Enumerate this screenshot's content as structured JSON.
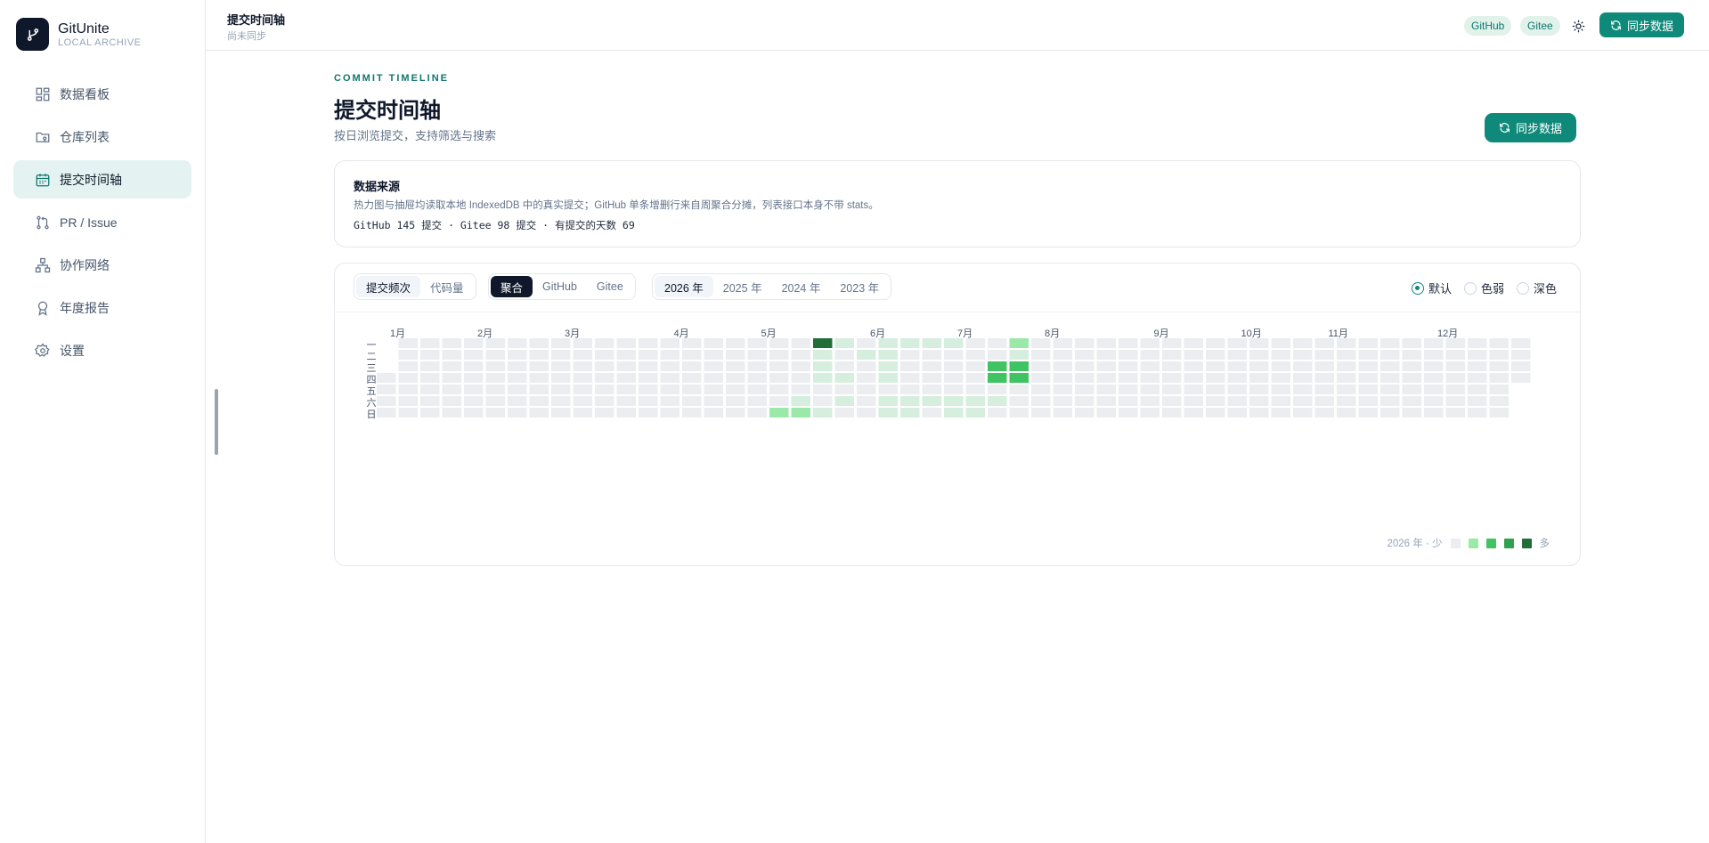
{
  "brand": {
    "name": "GitUnite",
    "subtitle": "LOCAL ARCHIVE"
  },
  "sidebar": {
    "items": [
      {
        "label": "数据看板",
        "icon": "dashboard-icon"
      },
      {
        "label": "仓库列表",
        "icon": "folder-repo-icon"
      },
      {
        "label": "提交时间轴",
        "icon": "calendar-icon",
        "active": true
      },
      {
        "label": "PR / Issue",
        "icon": "pull-request-icon"
      },
      {
        "label": "协作网络",
        "icon": "network-icon"
      },
      {
        "label": "年度报告",
        "icon": "award-icon"
      },
      {
        "label": "设置",
        "icon": "gear-icon"
      }
    ]
  },
  "header": {
    "title": "提交时间轴",
    "subtitle": "尚未同步",
    "tags": [
      "GitHub",
      "Gitee"
    ],
    "sync_label": "同步数据"
  },
  "page": {
    "eyebrow": "COMMIT TIMELINE",
    "title": "提交时间轴",
    "subtitle": "按日浏览提交，支持筛选与搜索",
    "sync_label": "同步数据"
  },
  "source": {
    "title": "数据来源",
    "description": "热力图与抽屉均读取本地 IndexedDB 中的真实提交；GitHub 单条增删行来自周聚合分摊，列表接口本身不带 stats。",
    "stats": "GitHub 145 提交 · Gitee 98 提交 · 有提交的天数 69"
  },
  "toolbar": {
    "metric_tabs": [
      "提交频次",
      "代码量"
    ],
    "metric_active": 0,
    "source_tabs": [
      "聚合",
      "GitHub",
      "Gitee"
    ],
    "source_active": 0,
    "year_tabs": [
      "2026 年",
      "2025 年",
      "2024 年",
      "2023 年"
    ],
    "year_active": 0,
    "palette_options": [
      "默认",
      "色弱",
      "深色"
    ],
    "palette_active": 0
  },
  "chart_data": {
    "type": "heatmap",
    "year": 2026,
    "months": [
      "1月",
      "2月",
      "3月",
      "4月",
      "5月",
      "6月",
      "7月",
      "8月",
      "9月",
      "10月",
      "11月",
      "12月"
    ],
    "weekdays": [
      "一",
      "二",
      "三",
      "四",
      "五",
      "六",
      "日"
    ],
    "levels": [
      "#ebedf0",
      "#d6eedd",
      "#9be9a8",
      "#40c463",
      "#30a14e",
      "#216e39"
    ],
    "active_days": [
      {
        "date": "2026-05-10",
        "level": 2
      },
      {
        "date": "2026-05-16",
        "level": 1
      },
      {
        "date": "2026-05-17",
        "level": 2
      },
      {
        "date": "2026-05-18",
        "level": 5
      },
      {
        "date": "2026-05-19",
        "level": 1
      },
      {
        "date": "2026-05-20",
        "level": 1
      },
      {
        "date": "2026-05-21",
        "level": 1
      },
      {
        "date": "2026-05-24",
        "level": 1
      },
      {
        "date": "2026-05-25",
        "level": 1
      },
      {
        "date": "2026-05-28",
        "level": 1
      },
      {
        "date": "2026-05-30",
        "level": 1
      },
      {
        "date": "2026-06-02",
        "level": 1
      },
      {
        "date": "2026-06-08",
        "level": 1
      },
      {
        "date": "2026-06-09",
        "level": 1
      },
      {
        "date": "2026-06-10",
        "level": 1
      },
      {
        "date": "2026-06-11",
        "level": 1
      },
      {
        "date": "2026-06-13",
        "level": 1
      },
      {
        "date": "2026-06-14",
        "level": 1
      },
      {
        "date": "2026-06-15",
        "level": 1
      },
      {
        "date": "2026-06-20",
        "level": 1
      },
      {
        "date": "2026-06-21",
        "level": 1
      },
      {
        "date": "2026-06-22",
        "level": 1
      },
      {
        "date": "2026-06-27",
        "level": 1
      },
      {
        "date": "2026-06-29",
        "level": 1
      },
      {
        "date": "2026-07-04",
        "level": 1
      },
      {
        "date": "2026-07-05",
        "level": 1
      },
      {
        "date": "2026-07-11",
        "level": 1
      },
      {
        "date": "2026-07-12",
        "level": 1
      },
      {
        "date": "2026-07-15",
        "level": 3
      },
      {
        "date": "2026-07-16",
        "level": 3
      },
      {
        "date": "2026-07-18",
        "level": 1
      },
      {
        "date": "2026-07-20",
        "level": 2
      },
      {
        "date": "2026-07-21",
        "level": 1
      },
      {
        "date": "2026-07-22",
        "level": 3
      },
      {
        "date": "2026-07-23",
        "level": 3
      }
    ],
    "legend": {
      "year_label": "2026 年 · 少",
      "more": "多"
    }
  }
}
